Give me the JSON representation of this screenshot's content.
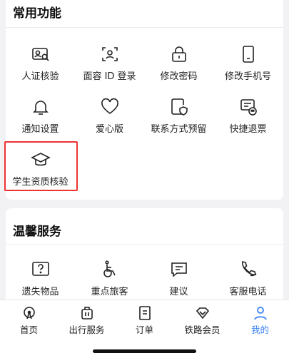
{
  "common": {
    "title": "常用功能",
    "items": [
      {
        "label": "人证核验",
        "icon": "id-card-verify-icon"
      },
      {
        "label": "面容 ID 登录",
        "icon": "face-id-icon"
      },
      {
        "label": "修改密码",
        "icon": "lock-icon"
      },
      {
        "label": "修改手机号",
        "icon": "phone-icon"
      },
      {
        "label": "通知设置",
        "icon": "bell-icon"
      },
      {
        "label": "爱心版",
        "icon": "heart-icon"
      },
      {
        "label": "联系方式预留",
        "icon": "contact-shield-icon"
      },
      {
        "label": "快捷退票",
        "icon": "ticket-refund-icon"
      },
      {
        "label": "学生资质核验",
        "icon": "graduation-cap-icon"
      }
    ]
  },
  "warm": {
    "title": "温馨服务",
    "items": [
      {
        "label": "遗失物品",
        "icon": "lost-item-icon"
      },
      {
        "label": "重点旅客",
        "icon": "wheelchair-icon"
      },
      {
        "label": "建议",
        "icon": "feedback-icon"
      },
      {
        "label": "客服电话",
        "icon": "phone-call-icon"
      }
    ]
  },
  "tabbar": {
    "items": [
      {
        "label": "首页",
        "icon": "home-icon"
      },
      {
        "label": "出行服务",
        "icon": "luggage-icon"
      },
      {
        "label": "订单",
        "icon": "order-icon"
      },
      {
        "label": "铁路会员",
        "icon": "diamond-icon"
      },
      {
        "label": "我的",
        "icon": "user-icon"
      }
    ],
    "active_color": "#3b82f6"
  }
}
